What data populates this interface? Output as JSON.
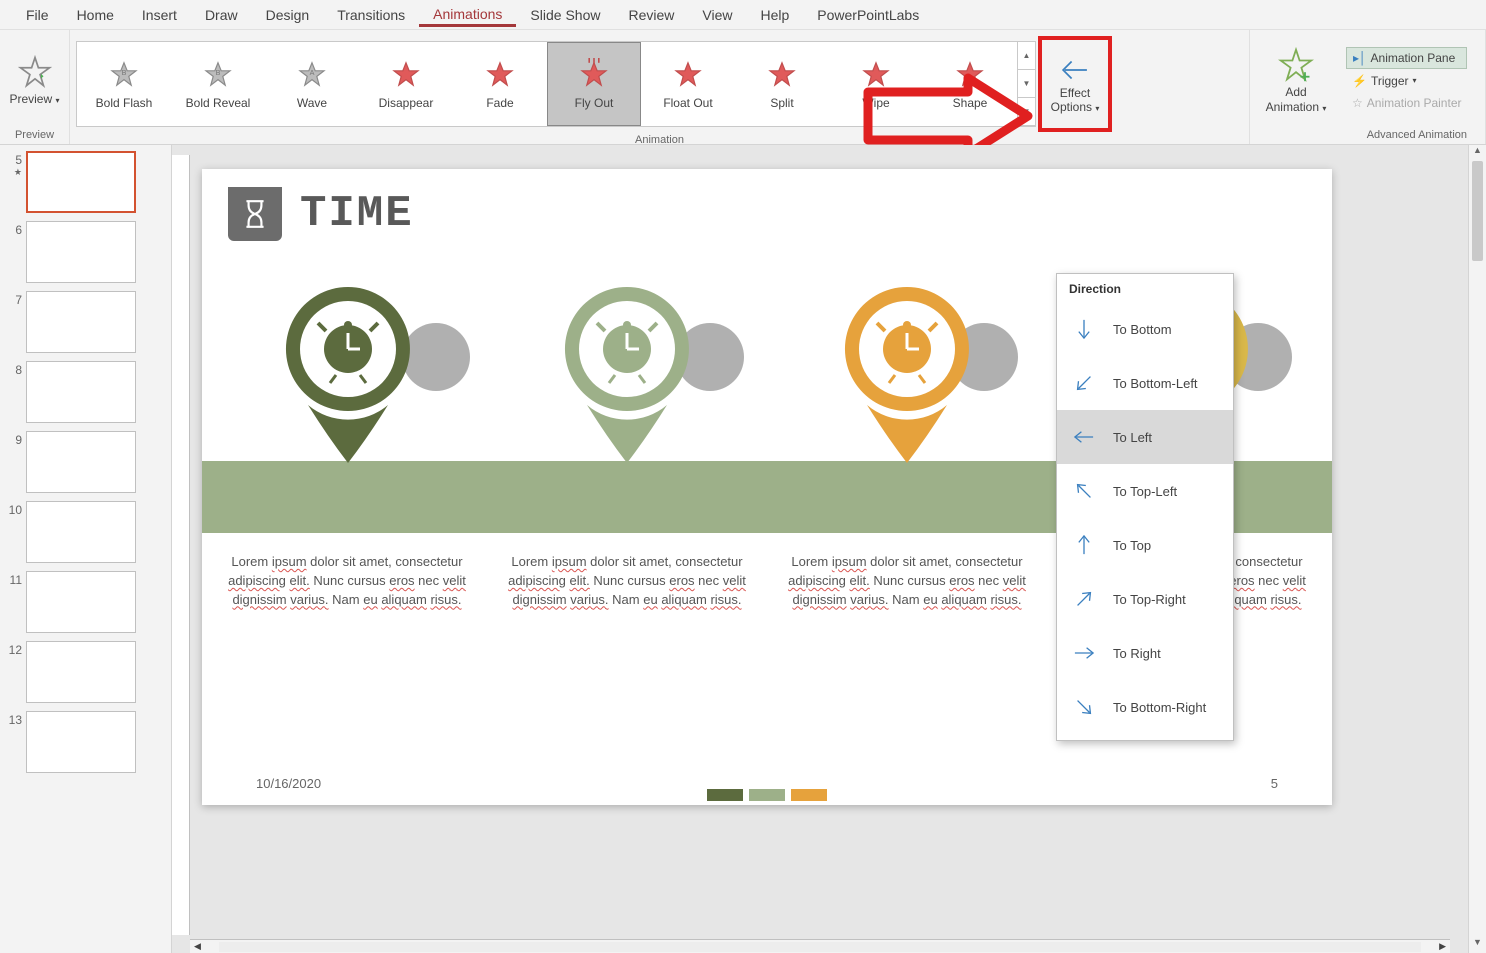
{
  "menu": {
    "tabs": [
      "File",
      "Home",
      "Insert",
      "Draw",
      "Design",
      "Transitions",
      "Animations",
      "Slide Show",
      "Review",
      "View",
      "Help",
      "PowerPointLabs"
    ],
    "active": "Animations"
  },
  "ribbon": {
    "preview": {
      "label": "Preview",
      "group": "Preview"
    },
    "animation_group": "Animation",
    "gallery": [
      {
        "label": "Bold Flash",
        "gray": true
      },
      {
        "label": "Bold Reveal",
        "gray": true
      },
      {
        "label": "Wave",
        "gray": true
      },
      {
        "label": "Disappear",
        "red": true
      },
      {
        "label": "Fade",
        "red": true
      },
      {
        "label": "Fly Out",
        "red": true,
        "selected": true,
        "lines": true
      },
      {
        "label": "Float Out",
        "red": true
      },
      {
        "label": "Split",
        "red": true
      },
      {
        "label": "Wipe",
        "red": true
      },
      {
        "label": "Shape",
        "red": true
      }
    ],
    "effect_options": {
      "line1": "Effect",
      "line2": "Options"
    },
    "add_animation": {
      "line1": "Add",
      "line2": "Animation"
    },
    "adv": {
      "pane": "Animation Pane",
      "trigger": "Trigger",
      "painter": "Animation Painter",
      "group": "Advanced Animation"
    }
  },
  "direction_menu": {
    "header": "Direction",
    "items": [
      {
        "label": "To Bottom",
        "rot": 90
      },
      {
        "label": "To Bottom-Left",
        "rot": 135
      },
      {
        "label": "To Left",
        "rot": 180,
        "selected": true
      },
      {
        "label": "To Top-Left",
        "rot": 225
      },
      {
        "label": "To Top",
        "rot": 270
      },
      {
        "label": "To Top-Right",
        "rot": 315
      },
      {
        "label": "To Right",
        "rot": 0
      },
      {
        "label": "To Bottom-Right",
        "rot": 45
      }
    ]
  },
  "thumbs": {
    "start": 5,
    "count": 9,
    "active": 5,
    "has_anim": [
      5
    ]
  },
  "slide": {
    "title": "TIME",
    "paragraph": "Lorem ipsum dolor sit amet, consectetur adipiscing elit. Nunc cursus eros nec velit dignissim varius. Nam eu aliquam risus.",
    "date": "10/16/2020",
    "page": "5",
    "pin_colors": [
      "#5c6b3e",
      "#9db089",
      "#e6a23c",
      "#d9b84a"
    ],
    "tab_colors": [
      "#5c6b3e",
      "#9db089",
      "#e6a23c"
    ]
  }
}
